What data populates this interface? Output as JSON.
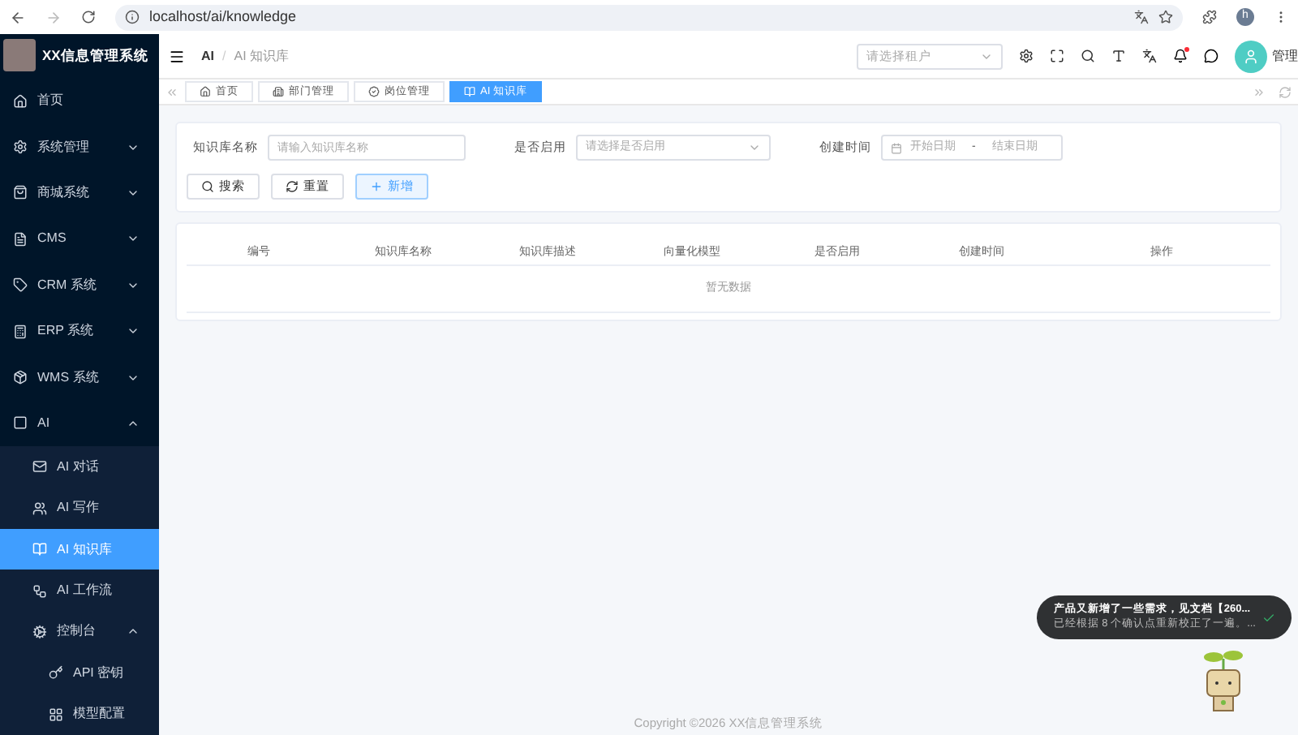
{
  "browser": {
    "url": "localhost/ai/knowledge",
    "profile": "h"
  },
  "sidebar": {
    "title": "XX信息管理系统",
    "items": [
      {
        "label": "首页",
        "selected": false
      },
      {
        "label": "系统管理",
        "selected": false,
        "expanded": false
      },
      {
        "label": "商城系统",
        "selected": false,
        "expanded": false
      },
      {
        "label": "CMS",
        "selected": false,
        "expanded": false
      },
      {
        "label": "CRM 系统",
        "selected": false,
        "expanded": false
      },
      {
        "label": "ERP 系统",
        "selected": false,
        "expanded": false
      },
      {
        "label": "WMS 系统",
        "selected": false,
        "expanded": false
      },
      {
        "label": "AI",
        "selected": false,
        "expanded": true,
        "children": [
          {
            "label": "AI 对话",
            "selected": false
          },
          {
            "label": "AI 写作",
            "selected": false
          },
          {
            "label": "AI 知识库",
            "selected": true
          },
          {
            "label": "AI 工作流",
            "selected": false
          },
          {
            "label": "控制台",
            "selected": false,
            "expanded": true,
            "children": [
              {
                "label": "API 密钥",
                "selected": false
              },
              {
                "label": "模型配置",
                "selected": false
              }
            ]
          }
        ]
      }
    ]
  },
  "header": {
    "breadcrumb": [
      "AI",
      "AI 知识库"
    ],
    "breadcrumb_separator": "/",
    "tenant_select": {
      "placeholder": "请选择租户"
    },
    "user": "管理"
  },
  "tabs": [
    {
      "label": "首页",
      "selected": false
    },
    {
      "label": "部门管理",
      "selected": false
    },
    {
      "label": "岗位管理",
      "selected": false
    },
    {
      "label": "AI 知识库",
      "selected": true
    }
  ],
  "search_form": {
    "fields": [
      {
        "kind": "input",
        "label": "知识库名称",
        "placeholder": "请输入知识库名称"
      },
      {
        "kind": "select",
        "label": "是否启用",
        "placeholder": "请选择是否启用"
      },
      {
        "kind": "daterange",
        "label": "创建时间",
        "start_placeholder": "开始日期",
        "separator": "-",
        "end_placeholder": "结束日期"
      }
    ],
    "buttons": [
      {
        "kind": "search",
        "label": "搜索"
      },
      {
        "kind": "reset",
        "label": "重置"
      },
      {
        "kind": "add",
        "label": "新增"
      }
    ]
  },
  "table": {
    "columns": [
      "编号",
      "知识库名称",
      "知识库描述",
      "向量化模型",
      "是否启用",
      "创建时间",
      "操作"
    ],
    "empty_text": "暂无数据"
  },
  "footer": {
    "copyright": "Copyright ©2026 XX信息管理系统"
  },
  "toast": {
    "title": "产品又新增了一些需求，见文档【260...",
    "message": "已经根据 8 个确认点重新校正了一遍。..."
  }
}
